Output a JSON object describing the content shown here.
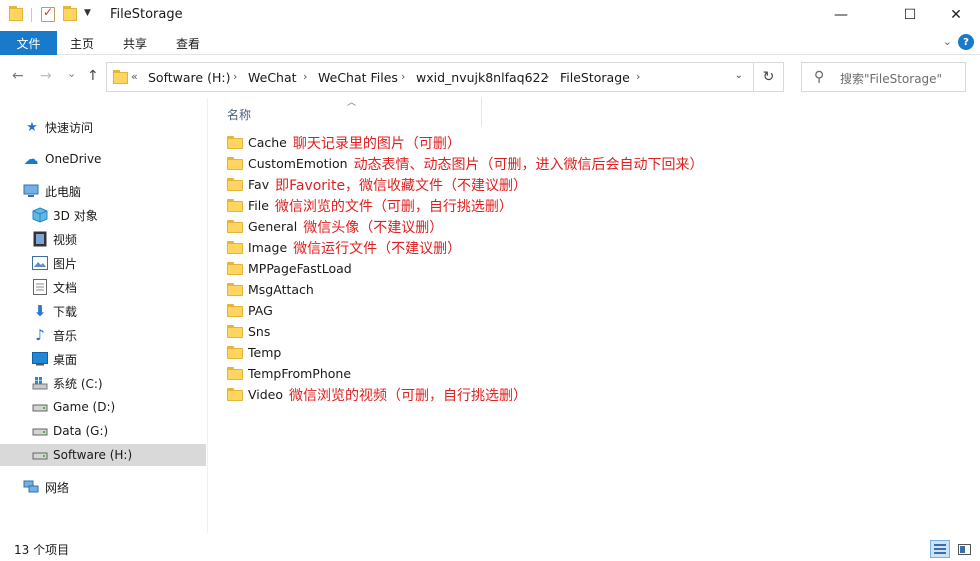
{
  "window": {
    "title": "FileStorage",
    "minimize": "—",
    "maximize": "☐",
    "close": "✕"
  },
  "ribbon": {
    "tabs": [
      "文件",
      "主页",
      "共享",
      "查看"
    ],
    "expand_icon": "chevron-down-icon",
    "help_icon": "?"
  },
  "nav": {
    "back": "←",
    "forward": "→",
    "recent": "⌄",
    "up": "↑",
    "breadcrumb_overflow": "«",
    "breadcrumbs": [
      "Software (H:)",
      "WeChat",
      "WeChat Files",
      "wxid_nvujk8nlfaq622",
      "FileStorage"
    ],
    "refresh": "↻",
    "search_placeholder": "搜索\"FileStorage\""
  },
  "sidebar": {
    "quick_access": "快速访问",
    "onedrive": "OneDrive",
    "this_pc": "此电脑",
    "pc_items": [
      "3D 对象",
      "视频",
      "图片",
      "文档",
      "下载",
      "音乐",
      "桌面"
    ],
    "drives": [
      "系统 (C:)",
      "Game (D:)",
      "Data (G:)",
      "Software (H:)"
    ],
    "selected_drive": "Software (H:)",
    "network": "网络"
  },
  "content": {
    "column_header": "名称",
    "rows": [
      {
        "name": "Cache",
        "note": "聊天记录里的图片（可删）"
      },
      {
        "name": "CustomEmotion",
        "note": "动态表情、动态图片（可删，进入微信后会自动下回来）"
      },
      {
        "name": "Fav",
        "note": "即Favorite，微信收藏文件（不建议删）"
      },
      {
        "name": "File",
        "note": "微信浏览的文件（可删，自行挑选删）"
      },
      {
        "name": "General",
        "note": "微信头像（不建议删）"
      },
      {
        "name": "Image",
        "note": "微信运行文件（不建议删）"
      },
      {
        "name": "MPPageFastLoad",
        "note": ""
      },
      {
        "name": "MsgAttach",
        "note": ""
      },
      {
        "name": "PAG",
        "note": ""
      },
      {
        "name": "Sns",
        "note": ""
      },
      {
        "name": "Temp",
        "note": ""
      },
      {
        "name": "TempFromPhone",
        "note": ""
      },
      {
        "name": "Video",
        "note": "微信浏览的视频（可删，自行挑选删）"
      }
    ]
  },
  "status": {
    "item_count": "13 个项目"
  },
  "colors": {
    "accent": "#1979ca",
    "annotation": "#e02020",
    "folder": "#ffd45f",
    "selected_bg": "#d9d9d9"
  }
}
